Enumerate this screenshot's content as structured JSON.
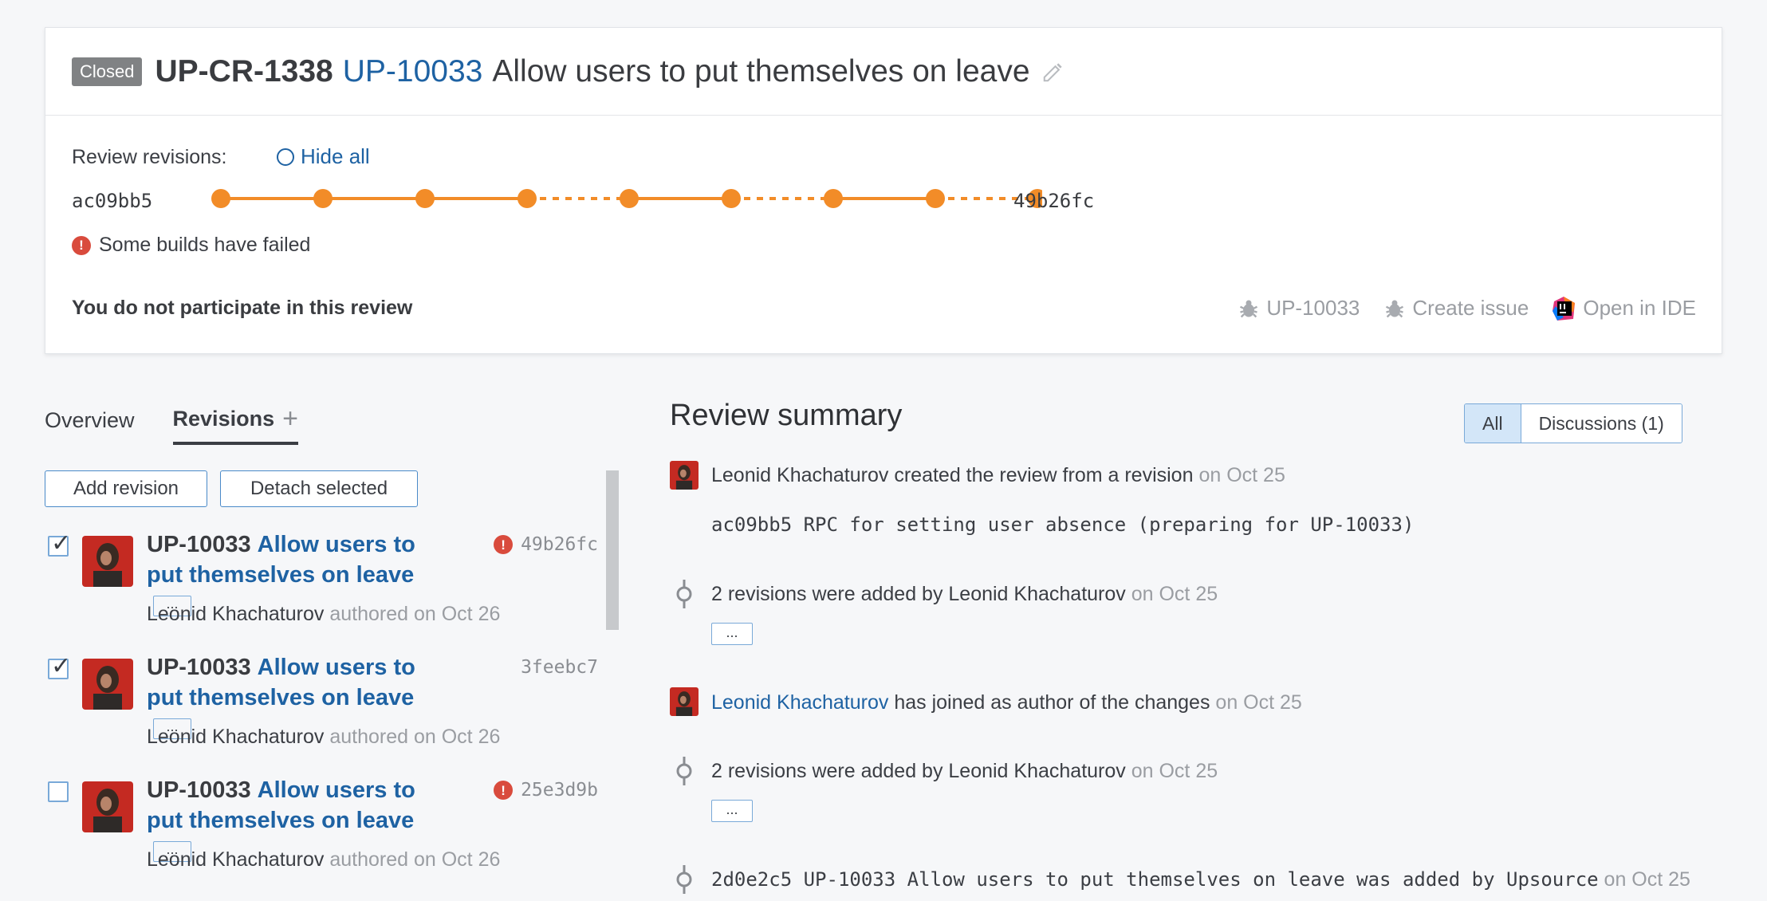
{
  "header": {
    "status_badge": "Closed",
    "review_id": "UP-CR-1338",
    "issue_id": "UP-10033",
    "title": "Allow users to put themselves on leave"
  },
  "revisions_bar": {
    "label": "Review revisions:",
    "hide_all": "Hide all",
    "start_hash": "ac09bb5",
    "end_hash": "49b26fc",
    "build_status": "Some builds have failed",
    "segments": [
      "solid",
      "solid",
      "solid",
      "dashed",
      "solid",
      "dashed",
      "solid",
      "dashed"
    ]
  },
  "participation": "You do not participate in this review",
  "actions": {
    "issue": "UP-10033",
    "create_issue": "Create issue",
    "open_ide": "Open in IDE"
  },
  "tabs": {
    "overview": "Overview",
    "revisions": "Revisions",
    "plus": "+"
  },
  "buttons": {
    "add_revision": "Add revision",
    "detach_selected": "Detach selected"
  },
  "revision_list": [
    {
      "checked": true,
      "issue": "UP-10033",
      "message": "Allow users to put themselves on leave",
      "msg_line1": "Allow users to",
      "msg_line2": "put themselves on leave",
      "hash": "49b26fc",
      "failed": true,
      "author": "Leonid Khachaturov",
      "meta": "authored on Oct 26",
      "ellipsis": "..."
    },
    {
      "checked": true,
      "issue": "UP-10033",
      "message": "Allow users to put themselves on leave",
      "msg_line1": "Allow users to",
      "msg_line2": "put themselves on leave",
      "hash": "3feebc7",
      "failed": false,
      "author": "Leonid Khachaturov",
      "meta": "authored on Oct 26",
      "ellipsis": "..."
    },
    {
      "checked": false,
      "issue": "UP-10033",
      "message": "Allow users to put themselves on leave",
      "msg_line1": "Allow users to",
      "msg_line2": "put themselves on leave",
      "hash": "25e3d9b",
      "failed": true,
      "author": "Leonid Khachaturov",
      "meta": "authored on Oct 26",
      "ellipsis": "..."
    }
  ],
  "summary": {
    "title": "Review summary",
    "filter_all": "All",
    "filter_discussions": "Discussions (1)",
    "events": {
      "e1_text": "Leonid Khachaturov created the review from a revision",
      "e1_date": "on Oct 25",
      "e1_commit": "ac09bb5 RPC for setting user absence (preparing for UP-10033)",
      "e2_text": "2 revisions were added by Leonid Khachaturov",
      "e2_date": "on Oct 25",
      "e3_link": "Leonid Khachaturov",
      "e3_text": "has joined as author of the changes",
      "e3_date": "on Oct 25",
      "e4_text": "2 revisions were added by Leonid Khachaturov",
      "e4_date": "on Oct 25",
      "e5_text": "2d0e2c5 UP-10033 Allow users to put themselves on leave was added by Upsource",
      "e5_date": "on Oct 25",
      "more": "..."
    }
  },
  "colors": {
    "accent": "#1e62a3",
    "timeline": "#f28c28",
    "error": "#d94b3d",
    "badge": "#808284"
  }
}
